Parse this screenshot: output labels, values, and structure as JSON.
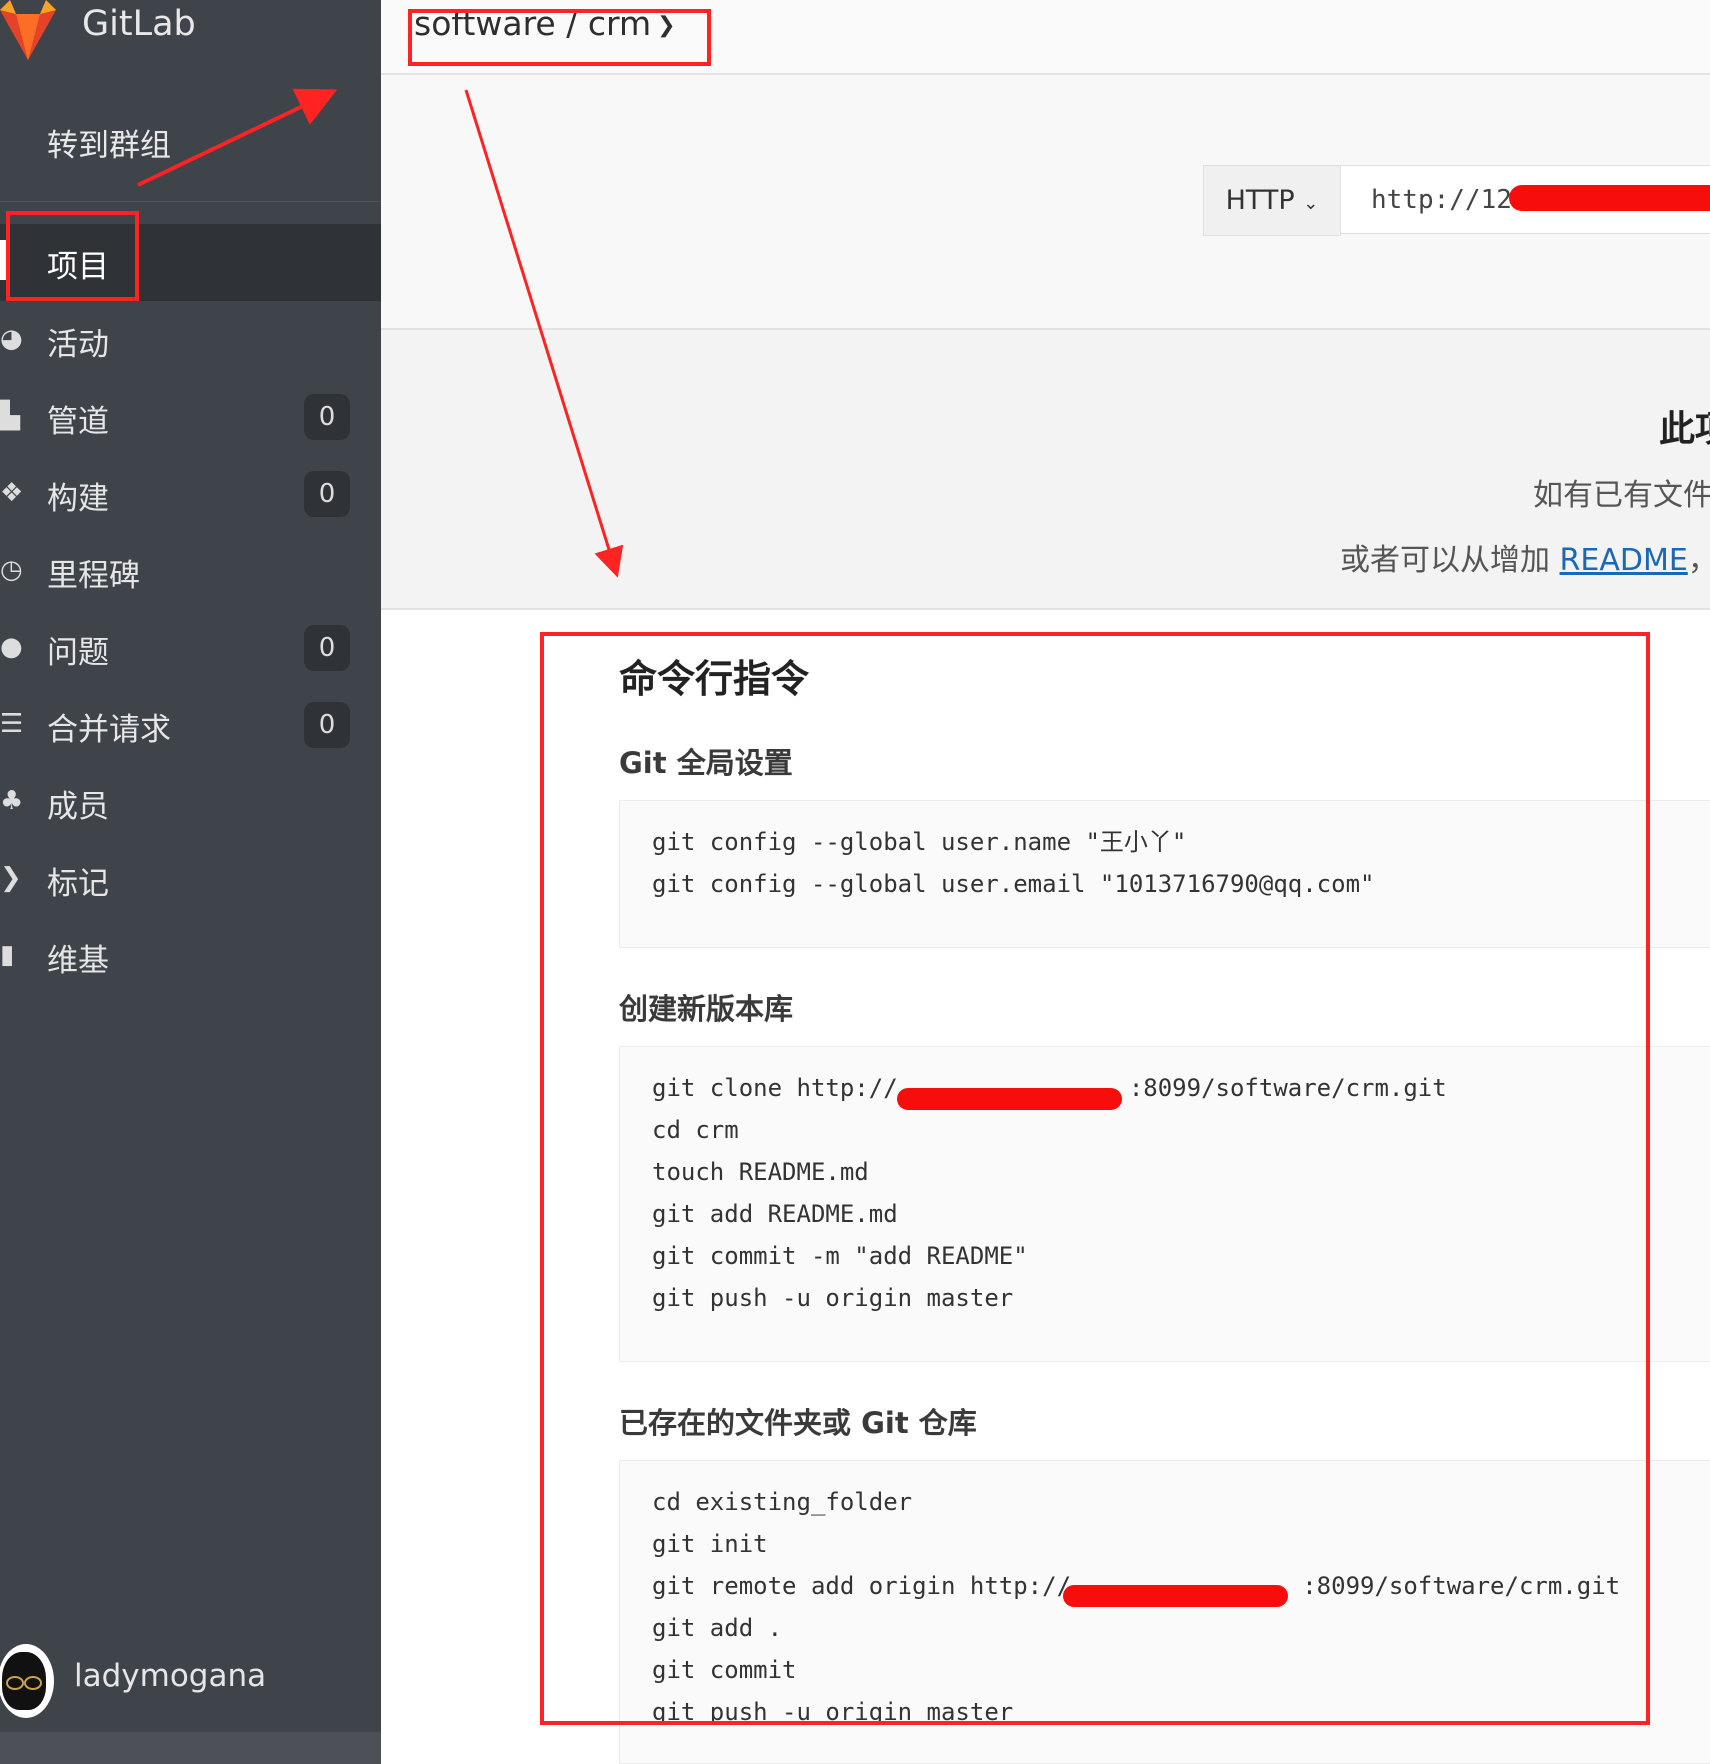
{
  "brand": {
    "name": "GitLab"
  },
  "sidebar": {
    "group_link": "转到群组",
    "items": [
      {
        "label": "项目",
        "icon": "home-icon",
        "count": null,
        "active": true
      },
      {
        "label": "活动",
        "icon": "dashboard-icon",
        "count": null
      },
      {
        "label": "管道",
        "icon": "ship-icon",
        "count": "0"
      },
      {
        "label": "构建",
        "icon": "cubes-icon",
        "count": "0"
      },
      {
        "label": "里程碑",
        "icon": "clock-icon",
        "count": null
      },
      {
        "label": "问题",
        "icon": "exclamation-circle-icon",
        "count": "0"
      },
      {
        "label": "合并请求",
        "icon": "merge-request-icon",
        "count": "0"
      },
      {
        "label": "成员",
        "icon": "users-icon",
        "count": null
      },
      {
        "label": "标记",
        "icon": "tags-icon",
        "count": null
      },
      {
        "label": "维基",
        "icon": "book-icon",
        "count": null
      }
    ],
    "user": {
      "name": "ladymogana"
    }
  },
  "header": {
    "project_path": "software / crm"
  },
  "clone": {
    "protocol": "HTTP",
    "url_visible": "http://12"
  },
  "empty_state": {
    "title": "此项",
    "line1": "如有已有文件",
    "line2_prefix": "或者可以从增加 ",
    "readme_link": "README",
    "line2_suffix": "， 或"
  },
  "instructions": {
    "title": "命令行指令",
    "sections": [
      {
        "title": "Git 全局设置",
        "lines": [
          "git config --global user.name \"王小丫\"",
          "git config --global user.email \"1013716790@qq.com\""
        ]
      },
      {
        "title": "创建新版本库",
        "lines": [
          "git clone http://                :8099/software/crm.git",
          "cd crm",
          "touch README.md",
          "git add README.md",
          "git commit -m \"add README\"",
          "git push -u origin master"
        ]
      },
      {
        "title": "已存在的文件夹或 Git 仓库",
        "lines": [
          "cd existing_folder",
          "git init",
          "git remote add origin http://                :8099/software/crm.git",
          "git add .",
          "git commit",
          "git push -u origin master"
        ]
      }
    ]
  },
  "colors": {
    "sidebar_bg": "#3f434a",
    "annotation_red": "#ff2323",
    "link_blue": "#1b69b6"
  }
}
